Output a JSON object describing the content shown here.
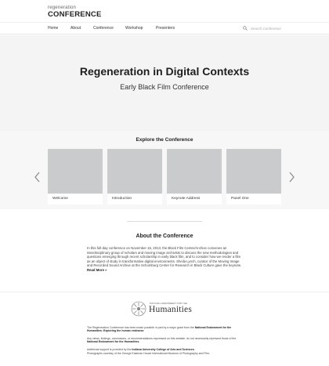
{
  "header": {
    "logo_top": "regeneration",
    "logo_main": "CONFERENCE"
  },
  "nav": {
    "items": [
      {
        "label": "Home"
      },
      {
        "label": "About"
      },
      {
        "label": "Conference"
      },
      {
        "label": "Workshop"
      },
      {
        "label": "Presenters"
      }
    ],
    "search_placeholder": "Search Conference",
    "search_icon": "search-icon"
  },
  "hero": {
    "title": "Regeneration in Digital Contexts",
    "subtitle": "Early Black Film Conference"
  },
  "explore": {
    "title": "Explore the Conference",
    "cards": [
      {
        "label": "Welcome"
      },
      {
        "label": "Introduction"
      },
      {
        "label": "Keynote Address"
      },
      {
        "label": "Panel One"
      }
    ],
    "prev_icon": "chevron-left-icon",
    "next_icon": "chevron-right-icon"
  },
  "about": {
    "title": "About the Conference",
    "body": "In this full-day conference on November 15, 2013, the Black Film Center/Archive convenes an interdisciplinary group of scholars and moving image archivists to discuss the new methodologies and questions emerging through recent scholarship in early black film, and to consider how we render a film as an object of study in transformative digital environments. Sheila Lynch, curator of the Moving Image and Recorded Sound Archive at the Schomburg Center for Research in Black Culture gave the keynote.",
    "read_more": "Read More »"
  },
  "neh": {
    "small_text": "NATIONAL ENDOWMENT FOR THE",
    "word": "Humanities"
  },
  "footer": {
    "p1_start": "The Regeneration Conference has been made possible in part by a major grant from the",
    "p1_bold": "National Endowment for the Humanities: Exploring the human endeavor.",
    "p2_start": "Any views, findings, conclusions, or recommendations expressed on this website, do not necessarily represent those of the",
    "p2_bold": "National Endowment for the Humanities.",
    "p3_start": "Additional support is provided by the",
    "p3_bold": "Indiana University College of Arts and Sciences.",
    "p4": "Photographs courtesy of the George Eastman House International Museum of Photography and Film."
  }
}
